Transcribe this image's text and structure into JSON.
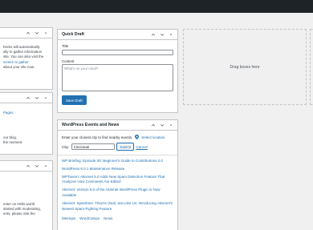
{
  "quick_draft": {
    "title": "Quick Draft",
    "title_label": "Title",
    "content_label": "Content",
    "content_placeholder": "What's on your mind?",
    "save_label": "Save Draft"
  },
  "events": {
    "title": "WordPress Events and News",
    "intro": "Enter your closest city to find nearby events.",
    "select_location": "Select location",
    "city_label": "City:",
    "city_value": "Cincinnati",
    "submit_label": "Submit",
    "cancel_label": "Cancel",
    "news": [
      "WP Briefing: Episode 30: Beginner's Guide to Contributions 2.0",
      "WordPress 6.0.1 Maintenance Release",
      "WPTavern: Akismet 5.0 Adds New Spam Detection Feature That Analyzes How Comments Are Edited",
      "Akismet: Version 5.0 of the Akismet WordPress Plugin is Now Available",
      "Akismet: Spambots: They're (Not) Just Like Us; Introducing Akismet's Newest Spam-Fighting Feature."
    ],
    "footer_partial": "Meetups    WordCamps    News"
  },
  "dropzone": {
    "label": "Drag boxes here"
  },
  "left_col": {
    "box1_lines": [
      "hecks will automatically",
      "ally to gather information",
      "site. You can also visit the",
      "screen to gather",
      "about your site now."
    ],
    "box1_link_word": "visit the",
    "box2_link": "Pages",
    "box2_lines": [
      "our blog.",
      "the moment."
    ],
    "box3_lines": [
      "enter on Hello world",
      "started with moderating,",
      "ents, please visit the"
    ]
  }
}
